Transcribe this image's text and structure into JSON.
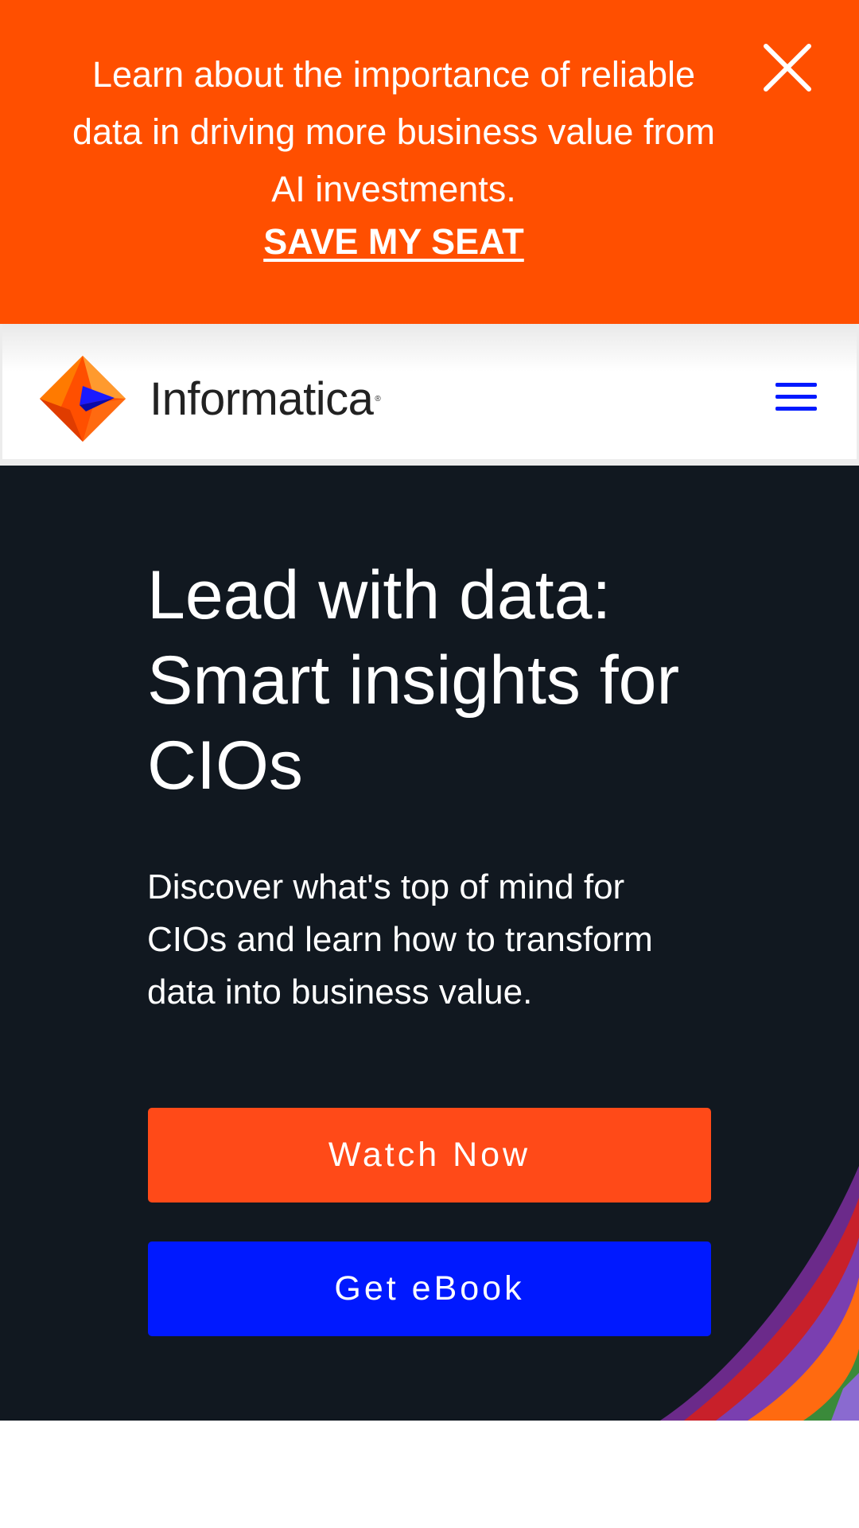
{
  "banner": {
    "message": "Learn about the importance of reliable data in driving more business value from AI investments.",
    "cta_label": "SAVE MY SEAT",
    "close_icon": "close-icon",
    "background_color": "#ff4f00"
  },
  "header": {
    "logo_text": "Informatica",
    "logo_icon": "informatica-logo-icon",
    "menu_icon": "hamburger-menu-icon",
    "menu_color": "#0019ff"
  },
  "hero": {
    "title": "Lead with data: Smart insights for CIOs",
    "description": "Discover what's top of mind for CIOs and learn how to transform data into business value.",
    "primary_button": "Watch Now",
    "secondary_button": "Get eBook",
    "background_color": "#111820",
    "primary_color": "#ff4a18",
    "secondary_color": "#0019ff"
  }
}
